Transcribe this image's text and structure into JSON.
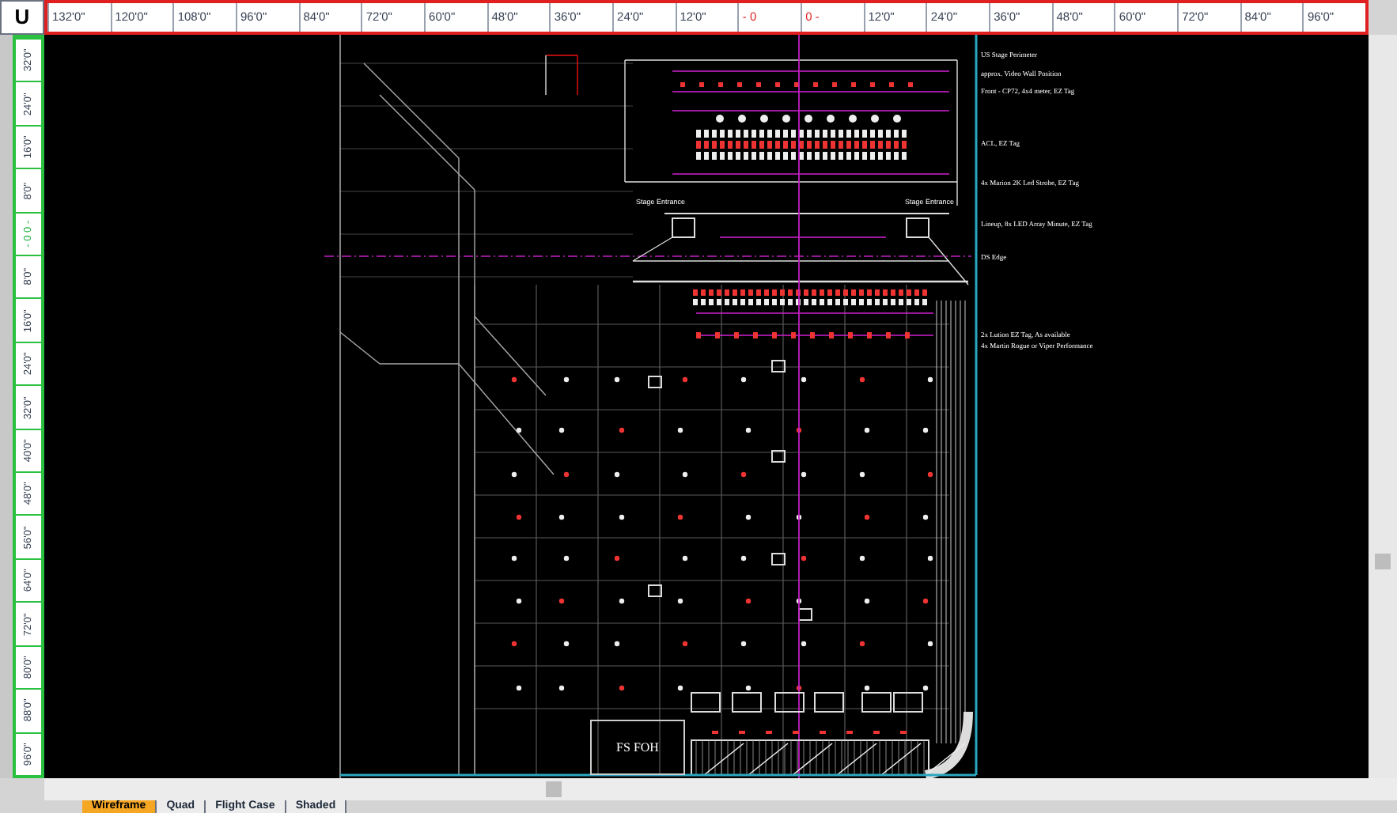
{
  "ruler": {
    "corner_label": "U",
    "top_labels": [
      {
        "text": "132'0\"",
        "kind": "mark"
      },
      {
        "text": "120'0\"",
        "kind": "mark"
      },
      {
        "text": "108'0\"",
        "kind": "mark"
      },
      {
        "text": "96'0\"",
        "kind": "mark"
      },
      {
        "text": "84'0\"",
        "kind": "mark"
      },
      {
        "text": "72'0\"",
        "kind": "mark"
      },
      {
        "text": "60'0\"",
        "kind": "mark"
      },
      {
        "text": "48'0\"",
        "kind": "mark"
      },
      {
        "text": "36'0\"",
        "kind": "mark"
      },
      {
        "text": "24'0\"",
        "kind": "mark"
      },
      {
        "text": "12'0\"",
        "kind": "mark"
      },
      {
        "text": "- 0",
        "kind": "origin"
      },
      {
        "text": "0 -",
        "kind": "origin"
      },
      {
        "text": "12'0\"",
        "kind": "mark"
      },
      {
        "text": "24'0\"",
        "kind": "mark"
      },
      {
        "text": "36'0\"",
        "kind": "mark"
      },
      {
        "text": "48'0\"",
        "kind": "mark"
      },
      {
        "text": "60'0\"",
        "kind": "mark"
      },
      {
        "text": "72'0\"",
        "kind": "mark"
      },
      {
        "text": "84'0\"",
        "kind": "mark"
      },
      {
        "text": "96'0\"",
        "kind": "mark"
      }
    ],
    "left_labels": [
      {
        "text": "32'0\"",
        "kind": "mark"
      },
      {
        "text": "24'0\"",
        "kind": "mark"
      },
      {
        "text": "16'0\"",
        "kind": "mark"
      },
      {
        "text": "8'0\"",
        "kind": "mark"
      },
      {
        "text": "- 0 0 -",
        "kind": "origin"
      },
      {
        "text": "8'0\"",
        "kind": "mark"
      },
      {
        "text": "16'0\"",
        "kind": "mark"
      },
      {
        "text": "24'0\"",
        "kind": "mark"
      },
      {
        "text": "32'0\"",
        "kind": "mark"
      },
      {
        "text": "40'0\"",
        "kind": "mark"
      },
      {
        "text": "48'0\"",
        "kind": "mark"
      },
      {
        "text": "56'0\"",
        "kind": "mark"
      },
      {
        "text": "64'0\"",
        "kind": "mark"
      },
      {
        "text": "72'0\"",
        "kind": "mark"
      },
      {
        "text": "80'0\"",
        "kind": "mark"
      },
      {
        "text": "88'0\"",
        "kind": "mark"
      },
      {
        "text": "96'0\"",
        "kind": "mark"
      }
    ]
  },
  "drawing": {
    "stage_labels": [
      "Stage Entrance",
      "Stage Entrance"
    ],
    "foh_label": "FS FOH",
    "annotations": [
      "US Stage Perimeter",
      "approx. Video Wall Position",
      "Front - CP72, 4x4 meter, EZ Tag",
      "ACL, EZ Tag",
      "4x Marion 2K Led Strobe, EZ Tag",
      "Lineup, 8x LED Array Minute, EZ Tag",
      "DS Edge",
      "2x Lution EZ Tag, As available",
      "4x Martin Rogue or Viper Performance"
    ]
  },
  "tabs": [
    {
      "label": "Wireframe",
      "selected": true
    },
    {
      "label": "Quad",
      "selected": false
    },
    {
      "label": "Flight Case",
      "selected": false
    },
    {
      "label": "Shaded",
      "selected": false
    }
  ]
}
